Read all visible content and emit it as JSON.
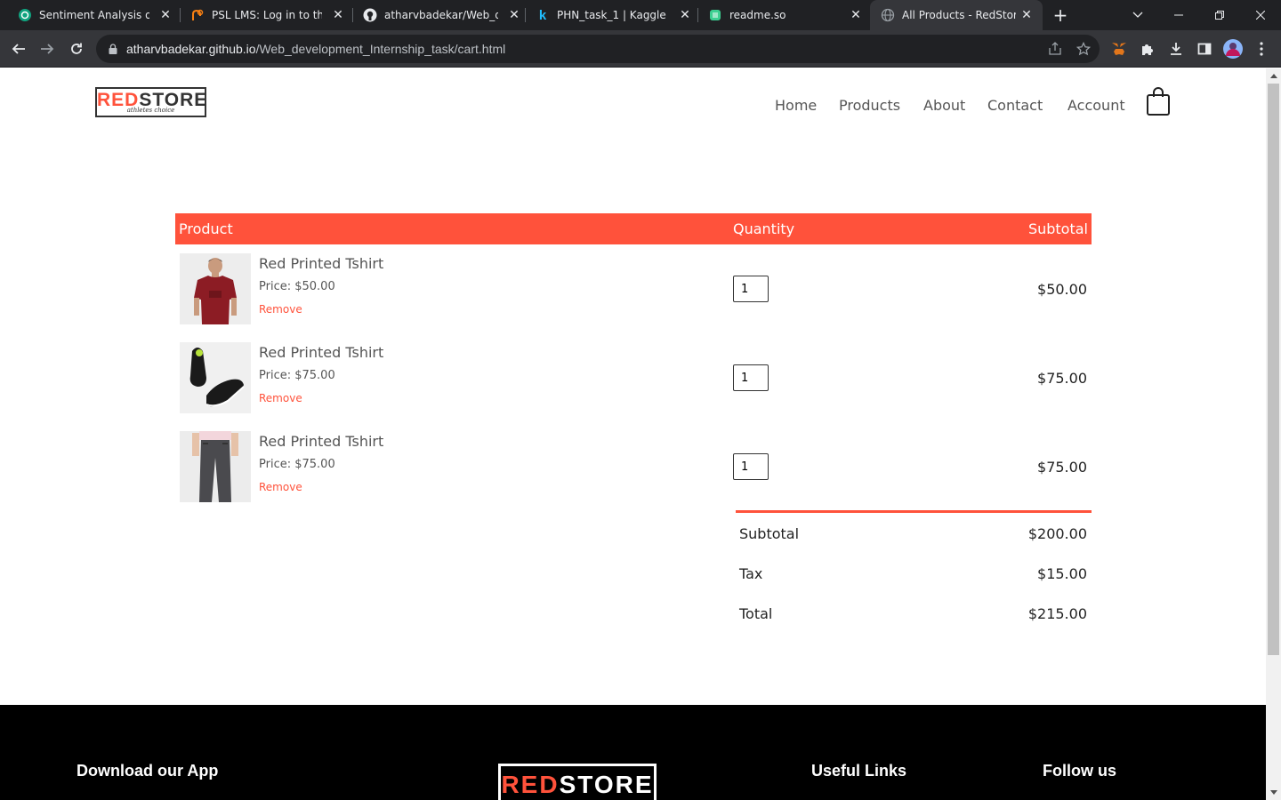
{
  "browser": {
    "tabs": [
      {
        "title": "Sentiment Analysis of An",
        "icon": "chatgpt-icon"
      },
      {
        "title": "PSL LMS: Log in to the si",
        "icon": "moodle-icon"
      },
      {
        "title": "atharvbadekar/Web_dev",
        "icon": "github-icon"
      },
      {
        "title": "PHN_task_1 | Kaggle",
        "icon": "kaggle-icon"
      },
      {
        "title": "readme.so",
        "icon": "readme-icon"
      },
      {
        "title": "All Products - RedStore",
        "icon": "globe-icon",
        "active": true
      }
    ],
    "url_host": "atharvbadekar.github.io",
    "url_path": "/Web_development_Internship_task/cart.html"
  },
  "site": {
    "logo": {
      "red": "RED",
      "rest": "STORE",
      "tagline": "athletes choice"
    },
    "nav": [
      "Home",
      "Products",
      "About",
      "Contact",
      "Account"
    ],
    "colors": {
      "accent": "#ff523b",
      "text": "#555555",
      "footer": "#000000"
    }
  },
  "cart": {
    "headers": {
      "product": "Product",
      "quantity": "Quantity",
      "subtotal": "Subtotal"
    },
    "items": [
      {
        "name": "Red Printed Tshirt",
        "price": "Price: $50.00",
        "remove": "Remove",
        "qty": "1",
        "subtotal": "$50.00",
        "image": "red-tshirt-image"
      },
      {
        "name": "Red Printed Tshirt",
        "price": "Price: $75.00",
        "remove": "Remove",
        "qty": "1",
        "subtotal": "$75.00",
        "image": "black-shoes-image"
      },
      {
        "name": "Red Printed Tshirt",
        "price": "Price: $75.00",
        "remove": "Remove",
        "qty": "1",
        "subtotal": "$75.00",
        "image": "grey-joggers-image"
      }
    ],
    "totals": [
      {
        "label": "Subtotal",
        "value": "$200.00"
      },
      {
        "label": "Tax",
        "value": "$15.00"
      },
      {
        "label": "Total",
        "value": "$215.00"
      }
    ]
  },
  "footer": {
    "download_app": "Download our App",
    "useful_links": "Useful Links",
    "follow_us": "Follow us",
    "logo": {
      "red": "RED",
      "rest": "STORE"
    }
  }
}
